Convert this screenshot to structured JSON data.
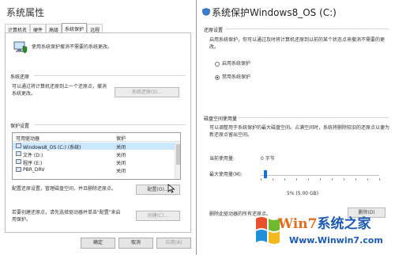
{
  "left": {
    "title": "系统属性",
    "tabs": [
      "计算机名",
      "硬件",
      "高级",
      "系统保护",
      "远程"
    ],
    "intro": "使用系统保护撤消不需要的系统更改。",
    "restore": {
      "section": "系统还原",
      "desc": "可以通过将计算机还原到上一个还原点，撤消系统更改。",
      "button": "系统还原(S)..."
    },
    "protection": {
      "section": "保护设置",
      "col_drive": "可用驱动器",
      "col_protect": "保护",
      "rows": [
        {
          "drive": "Windows8_OS (C:) (系统)",
          "protect": "关闭"
        },
        {
          "drive": "文件 (D:)",
          "protect": "关闭"
        },
        {
          "drive": "程序 (E:)",
          "protect": "关闭"
        },
        {
          "drive": "PBR_DRV",
          "protect": "关闭"
        }
      ]
    },
    "configure": {
      "desc": "配置还原设置，管理磁盘空间，并且删除还原点。",
      "button": "配置(O)..."
    },
    "create": {
      "desc": "若要创建还原点，请先选择驱动器并单击\"配置\"来启用保护。",
      "button": "创建(C)..."
    },
    "footer": {
      "ok": "确定",
      "cancel": "取消",
      "apply": "应用(A)"
    }
  },
  "right": {
    "title": "系统保护Windows8_OS (C:)",
    "restore_settings": {
      "section": "还原设置",
      "desc": "启用系统保护，你可以通过及时将计算机还原到以前的某个状态点来撤消不需要的更改。",
      "option_on": "启用系统保护",
      "option_off": "禁用系统保护",
      "selected": "option_off"
    },
    "disk": {
      "section": "磁盘空间使用量",
      "desc": "可以调整用于系统保护的最大磁盘空间。占满空间时，系统将删除较旧的还原点以便为新还原点留出空间。",
      "current_label": "当前使用量:",
      "current_value": "0 字节",
      "max_label": "最大使用量(M):",
      "max_value": "5% (5.00 GB)",
      "slider_fraction": 0.03,
      "delete_desc": "删除此驱动器的所有还原点。",
      "delete_button": "删除(D)"
    }
  },
  "watermark": {
    "title_main": "Win7",
    "title_rest": "系统之家",
    "url": "Www.Winwin7.com"
  },
  "colors": {
    "selection": "#cce8ff",
    "slider": "#1e6fd0",
    "watermark_blue": "#1b5ab0",
    "watermark_orange": "#e07020"
  }
}
